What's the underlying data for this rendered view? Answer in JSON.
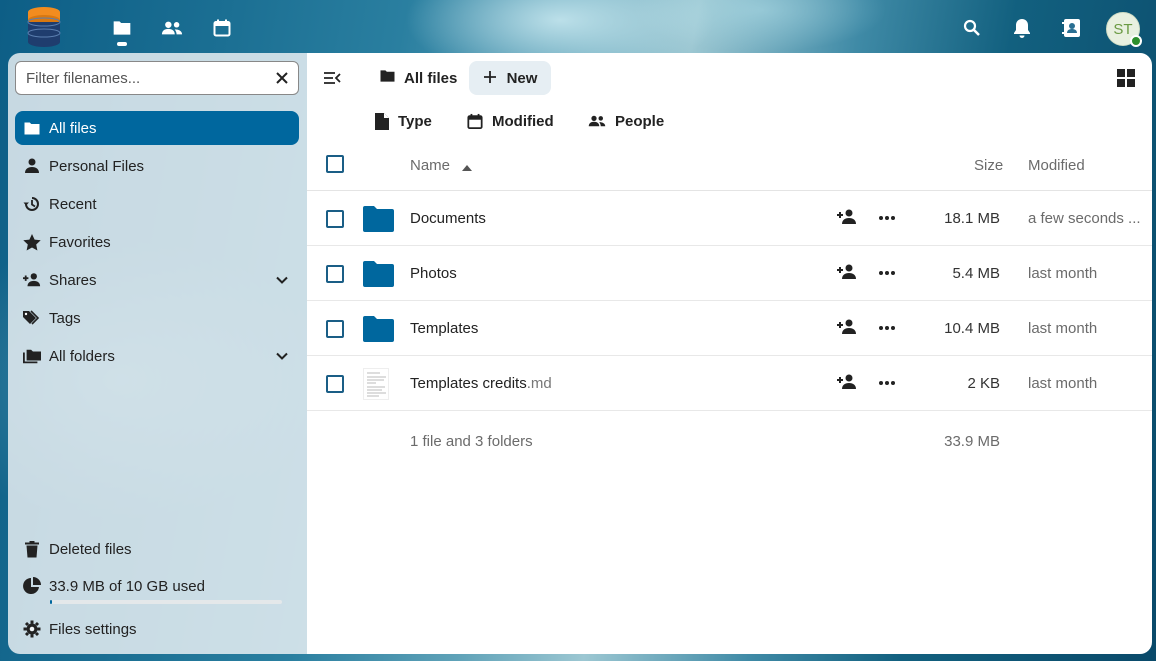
{
  "header": {
    "apps": [
      {
        "name": "files-app",
        "icon": "folder-icon",
        "active": true
      },
      {
        "name": "contacts-app",
        "icon": "contacts-icon"
      },
      {
        "name": "calendar-app",
        "icon": "calendar-icon"
      }
    ],
    "avatar_initials": "ST",
    "right_icons": [
      "search-icon",
      "bell-icon",
      "address-book-icon"
    ]
  },
  "sidebar": {
    "filter_placeholder": "Filter filenames...",
    "items": [
      {
        "label": "All files",
        "icon": "folder-icon",
        "active": true
      },
      {
        "label": "Personal Files",
        "icon": "person-icon"
      },
      {
        "label": "Recent",
        "icon": "history-icon"
      },
      {
        "label": "Favorites",
        "icon": "star-icon"
      },
      {
        "label": "Shares",
        "icon": "share-icon",
        "expandable": true
      },
      {
        "label": "Tags",
        "icon": "tag-icon"
      },
      {
        "label": "All folders",
        "icon": "folder-multiple-icon",
        "expandable": true
      }
    ],
    "bottom": {
      "deleted": "Deleted files",
      "quota": "33.9 MB of 10 GB used",
      "quota_fraction": 0.0034,
      "settings": "Files settings"
    }
  },
  "main": {
    "breadcrumb": "All files",
    "new_label": "New",
    "filters": [
      {
        "label": "Type",
        "icon": "file-icon"
      },
      {
        "label": "Modified",
        "icon": "calendar-icon"
      },
      {
        "label": "People",
        "icon": "people-icon"
      }
    ],
    "columns": {
      "name": "Name",
      "size": "Size",
      "modified": "Modified"
    },
    "rows": [
      {
        "name": "Documents",
        "ext": "",
        "type": "folder",
        "size": "18.1 MB",
        "modified": "a few seconds ..."
      },
      {
        "name": "Photos",
        "ext": "",
        "type": "folder",
        "size": "5.4 MB",
        "modified": "last month"
      },
      {
        "name": "Templates",
        "ext": "",
        "type": "folder",
        "size": "10.4 MB",
        "modified": "last month"
      },
      {
        "name": "Templates credits",
        "ext": ".md",
        "type": "file",
        "size": "2 KB",
        "modified": "last month"
      }
    ],
    "summary": "1 file and 3 folders",
    "summary_size": "33.9 MB"
  },
  "colors": {
    "primary": "#00679e",
    "folder": "#00679e",
    "new_button_bg": "#e6eef3"
  }
}
